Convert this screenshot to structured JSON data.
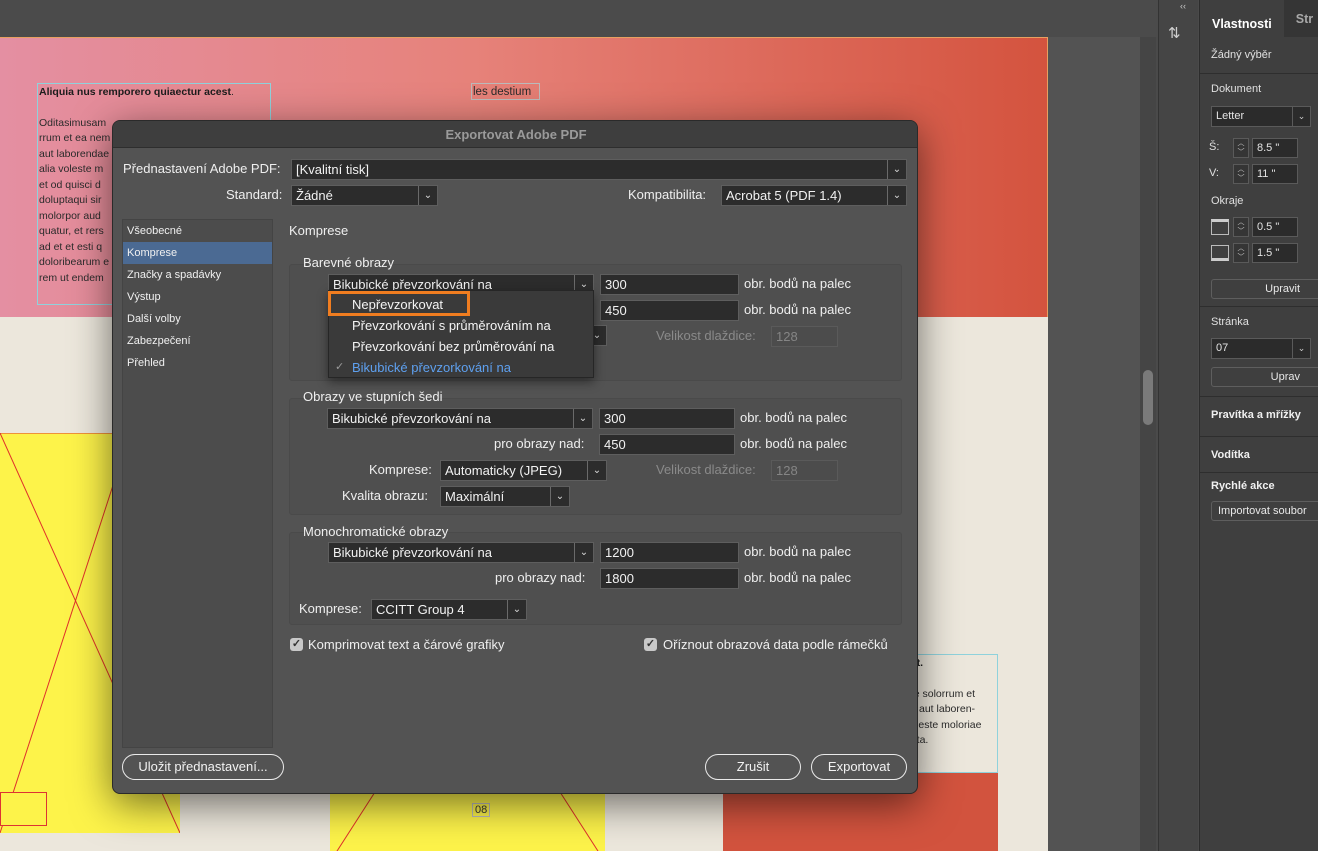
{
  "document": {
    "frame1_title": "Aliquia nus remporero quiaectur acest",
    "frame1_lines": [
      "Oditasimusam",
      "rrum et ea nem",
      "aut laborendae",
      "alia voleste m",
      "et od quisci d",
      "doluptaqui sir",
      "molorpor aud",
      "quatur, et rers",
      "ad et et esti q",
      "doloribearum e",
      "rem ut endem"
    ],
    "frame2_text": "les destium",
    "frame3_title": "est.",
    "frame3_lines": [
      "ate solorrum et",
      "us aut laboren-",
      "voleste moloriae",
      "upta."
    ],
    "page_number": "08"
  },
  "properties_panel": {
    "collapse_label": "‹‹",
    "tabs": [
      "Vlastnosti",
      "Str"
    ],
    "no_selection": "Žádný výběr",
    "document_heading": "Dokument",
    "page_size": "Letter",
    "width_label": "Š:",
    "width_value": "8.5 \"",
    "height_label": "V:",
    "height_value": "11 \"",
    "margins_heading": "Okraje",
    "margin_top": "0.5 \"",
    "margin_bottom": "1.5 \"",
    "edit_button": "Upravit",
    "page_heading": "Stránka",
    "page_value": "07",
    "edit_page_button": "Uprav",
    "rulers_grids": "Pravítka a mřížky",
    "guides": "Vodítka",
    "quick_actions": "Rychlé akce",
    "import_button": "Importovat soubor"
  },
  "dialog": {
    "title": "Exportovat Adobe PDF",
    "preset_label": "Přednastavení Adobe PDF:",
    "preset_value": "[Kvalitní tisk]",
    "standard_label": "Standard:",
    "standard_value": "Žádné",
    "compat_label": "Kompatibilita:",
    "compat_value": "Acrobat 5 (PDF 1.4)",
    "categories": [
      "Všeobecné",
      "Komprese",
      "Značky a spadávky",
      "Výstup",
      "Další volby",
      "Zabezpečení",
      "Přehled"
    ],
    "selected_category": "Komprese",
    "section_title": "Komprese",
    "color_images": {
      "title": "Barevné obrazy",
      "resample": "Bikubické převzorkování na",
      "ppi": "300",
      "ppi_unit": "obr. bodů na palec",
      "above_ppi": "450",
      "above_unit": "obr. bodů na palec",
      "tile_label": "Velikost dlaždice:",
      "tile_value": "128"
    },
    "dropdown": {
      "items": [
        "Nepřevzorkovat",
        "Převzorkování s průměrováním na",
        "Převzorkování bez průměrování na",
        "Bikubické převzorkování na"
      ],
      "checked_index": 3,
      "highlighted_index": 0
    },
    "gray_images": {
      "title": "Obrazy ve stupních šedi",
      "resample": "Bikubické převzorkování na",
      "ppi": "300",
      "ppi_unit": "obr. bodů na palec",
      "above_label": "pro obrazy nad:",
      "above_ppi": "450",
      "above_unit": "obr. bodů na palec",
      "compression_label": "Komprese:",
      "compression_value": "Automaticky (JPEG)",
      "tile_label": "Velikost dlaždice:",
      "tile_value": "128",
      "quality_label": "Kvalita obrazu:",
      "quality_value": "Maximální"
    },
    "mono_images": {
      "title": "Monochromatické obrazy",
      "resample": "Bikubické převzorkování na",
      "ppi": "1200",
      "ppi_unit": "obr. bodů na palec",
      "above_label": "pro obrazy nad:",
      "above_ppi": "1800",
      "above_unit": "obr. bodů na palec",
      "compression_label": "Komprese:",
      "compression_value": "CCITT Group 4"
    },
    "compress_text_label": "Komprimovat text a čárové grafiky",
    "crop_label": "Oříznout obrazová data podle rámečků",
    "save_preset_button": "Uložit přednastavení...",
    "cancel_button": "Zrušit",
    "export_button": "Exportovat",
    "colors": {
      "selected_category": "#4b6a93",
      "highlight": "#f07d20",
      "checked_item": "#5ea0ef"
    }
  }
}
